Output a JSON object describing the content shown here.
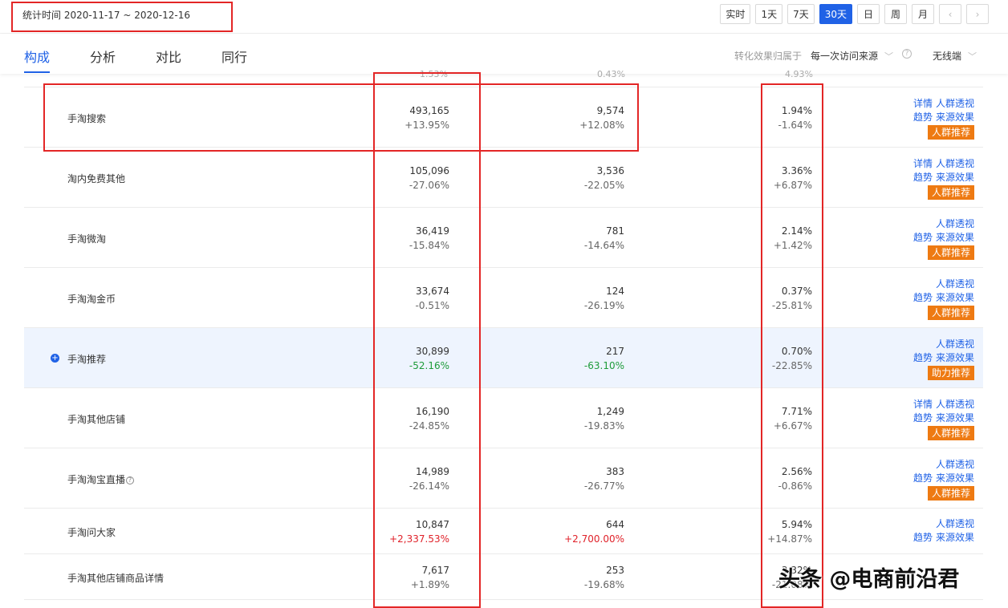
{
  "header": {
    "date_range": "统计时间 2020-11-17 ~ 2020-12-16",
    "periods": [
      "实时",
      "1天",
      "7天",
      "30天",
      "日",
      "周",
      "月"
    ],
    "active_period": "30天",
    "prev_arrow": "‹",
    "next_arrow": "›"
  },
  "tabs": [
    {
      "label": "构成"
    },
    {
      "label": "分析"
    },
    {
      "label": "对比"
    },
    {
      "label": "同行"
    }
  ],
  "attribution": {
    "label": "转化效果归属于",
    "value": "每一次访问来源",
    "device": "无线端",
    "help": "?"
  },
  "cutoff_row": {
    "a": "1.53%",
    "b": "0.43%",
    "c": "4.93%"
  },
  "rows": [
    {
      "name": "手淘搜索",
      "v1": "493,165",
      "c1": "+13.95%",
      "v2": "9,574",
      "c2": "+12.08%",
      "v3": "1.94%",
      "c3": "-1.64%",
      "detail": "详情",
      "crowd": "人群透视",
      "trend": "趋势",
      "source": "来源效果",
      "btn": "人群推荐"
    },
    {
      "name": "淘内免费其他",
      "v1": "105,096",
      "c1": "-27.06%",
      "v2": "3,536",
      "c2": "-22.05%",
      "v3": "3.36%",
      "c3": "+6.87%",
      "detail": "详情",
      "crowd": "人群透视",
      "trend": "趋势",
      "source": "来源效果",
      "btn": "人群推荐"
    },
    {
      "name": "手淘微淘",
      "v1": "36,419",
      "c1": "-15.84%",
      "v2": "781",
      "c2": "-14.64%",
      "v3": "2.14%",
      "c3": "+1.42%",
      "crowd": "人群透视",
      "trend": "趋势",
      "source": "来源效果",
      "btn": "人群推荐"
    },
    {
      "name": "手淘淘金币",
      "v1": "33,674",
      "c1": "-0.51%",
      "v2": "124",
      "c2": "-26.19%",
      "v3": "0.37%",
      "c3": "-25.81%",
      "crowd": "人群透视",
      "trend": "趋势",
      "source": "来源效果",
      "btn": "人群推荐"
    },
    {
      "name": "手淘推荐",
      "v1": "30,899",
      "c1": "-52.16%",
      "v2": "217",
      "c2": "-63.10%",
      "v3": "0.70%",
      "c3": "-22.85%",
      "crowd": "人群透视",
      "trend": "趋势",
      "source": "来源效果",
      "btn": "助力推荐",
      "expand": "+"
    },
    {
      "name": "手淘其他店铺",
      "v1": "16,190",
      "c1": "-24.85%",
      "v2": "1,249",
      "c2": "-19.83%",
      "v3": "7.71%",
      "c3": "+6.67%",
      "detail": "详情",
      "crowd": "人群透视",
      "trend": "趋势",
      "source": "来源效果",
      "btn": "人群推荐"
    },
    {
      "name": "手淘淘宝直播",
      "v1": "14,989",
      "c1": "-26.14%",
      "v2": "383",
      "c2": "-26.77%",
      "v3": "2.56%",
      "c3": "-0.86%",
      "crowd": "人群透视",
      "trend": "趋势",
      "source": "来源效果",
      "btn": "人群推荐",
      "help": "?"
    },
    {
      "name": "手淘问大家",
      "v1": "10,847",
      "c1": "+2,337.53%",
      "v2": "644",
      "c2": "+2,700.00%",
      "v3": "5.94%",
      "c3": "+14.87%",
      "crowd": "人群透视",
      "trend": "趋势",
      "source": "来源效果"
    },
    {
      "name": "手淘其他店铺商品详情",
      "v1": "7,617",
      "c1": "+1.89%",
      "v2": "253",
      "c2": "-19.68%",
      "v3": "3.32%",
      "c3": "-21.08%"
    }
  ],
  "colors": {
    "accent": "#2062e6",
    "orange_button": "#ee7a12",
    "annotation_red": "#e32626",
    "negative_green": "#1e9b3a",
    "positive_red": "#e0222a"
  },
  "watermark": "头条 @电商前沿君"
}
